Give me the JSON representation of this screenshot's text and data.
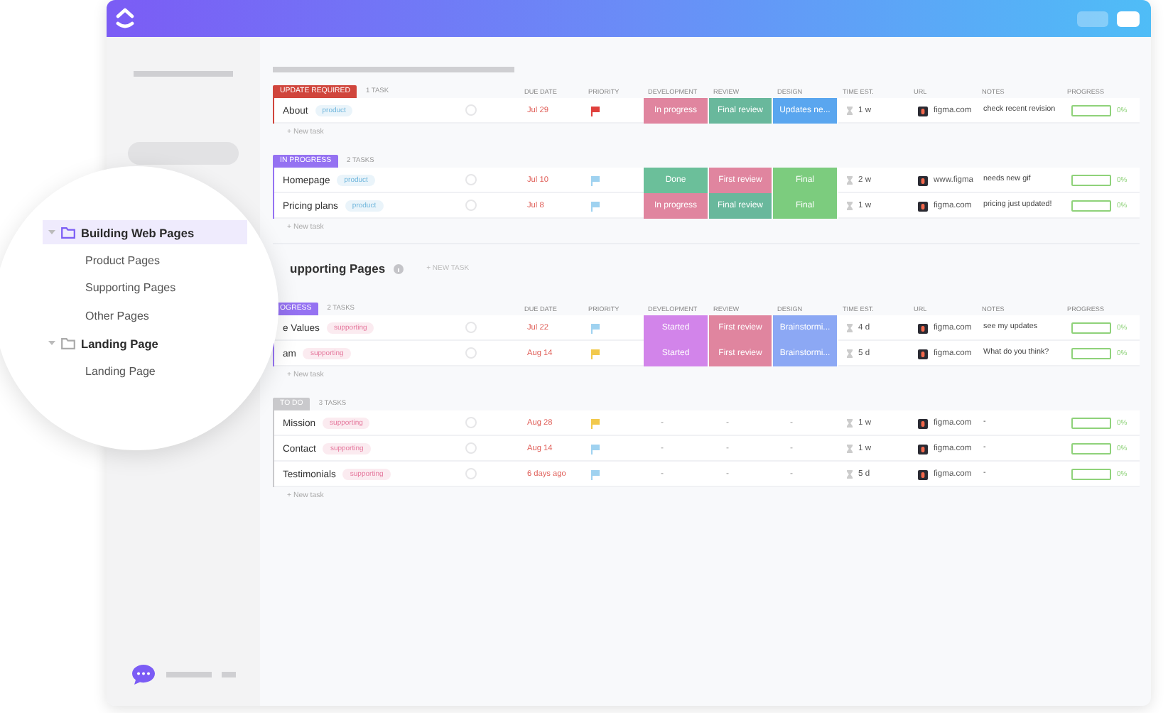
{
  "sections": [
    {
      "groups": [
        {
          "badge": {
            "text": "UPDATE REQUIRED",
            "color": "#d0453c"
          },
          "count": "1 TASK",
          "columns": [
            "DUE DATE",
            "PRIORITY",
            "DEVELOPMENT",
            "REVIEW",
            "DESIGN",
            "TIME EST.",
            "URL",
            "NOTES",
            "PROGRESS"
          ],
          "new_task": "+ New task",
          "rows": [
            {
              "name": "About",
              "tag": {
                "text": "product",
                "color": "#6fb6dc"
              },
              "due": "Jul 29",
              "priority": {
                "color": "#e0403c"
              },
              "development": {
                "text": "In progress",
                "color": "#e0859f"
              },
              "review": {
                "text": "Final review",
                "color": "#69b89c"
              },
              "design": {
                "text": "Updates ne...",
                "color": "#5aa6ef"
              },
              "time": "1 w",
              "url": "figma.com",
              "notes": "check recent revision",
              "progress": {
                "level": 0,
                "reading": "0%"
              }
            }
          ]
        },
        {
          "badge": {
            "text": "IN PROGRESS",
            "color": "#9572f2"
          },
          "count": "2 TASKS",
          "new_task": "+ New task",
          "rows": [
            {
              "name": "Homepage",
              "tag": {
                "text": "product",
                "color": "#6fb6dc"
              },
              "due": "Jul 10",
              "priority": {
                "color": "#9fd2f0"
              },
              "development": {
                "text": "Done",
                "color": "#6bbf9a"
              },
              "review": {
                "text": "First review",
                "color": "#e0859f"
              },
              "design": {
                "text": "Final",
                "color": "#7ccc7e"
              },
              "time": "2 w",
              "url": "www.figma",
              "notes": "needs new gif",
              "progress": {
                "level": 0,
                "reading": "0%"
              }
            },
            {
              "name": "Pricing plans",
              "tag": {
                "text": "product",
                "color": "#6fb6dc"
              },
              "due": "Jul 8",
              "priority": {
                "color": "#9fd2f0"
              },
              "development": {
                "text": "In progress",
                "color": "#e0859f"
              },
              "review": {
                "text": "Final review",
                "color": "#69b89c"
              },
              "design": {
                "text": "Final",
                "color": "#7ccc7e"
              },
              "time": "1 w",
              "url": "figma.com",
              "notes": "pricing just updated!",
              "progress": {
                "level": 0,
                "reading": "0%"
              }
            }
          ]
        }
      ]
    },
    {
      "title": "upporting Pages",
      "new_task": "+ NEW TASK",
      "groups": [
        {
          "badge": {
            "text": "OGRESS",
            "color": "#9572f2"
          },
          "count": "2 TASKS",
          "columns": [
            "DUE DATE",
            "PRIORITY",
            "DEVELOPMENT",
            "REVIEW",
            "DESIGN",
            "TIME EST.",
            "URL",
            "NOTES",
            "PROGRESS"
          ],
          "new_task": "+ New task",
          "rows": [
            {
              "name": "e Values",
              "tag": {
                "text": "supporting",
                "color": "#e5779c"
              },
              "due": "Jul 22",
              "priority": {
                "color": "#9fd2f0"
              },
              "development": {
                "text": "Started",
                "color": "#d284ea"
              },
              "review": {
                "text": "First review",
                "color": "#e0859f"
              },
              "design": {
                "text": "Brainstormi...",
                "color": "#8ca8f4"
              },
              "time": "4 d",
              "url": "figma.com",
              "notes": "see my updates",
              "progress": {
                "level": 0,
                "reading": "0%"
              }
            },
            {
              "name": "am",
              "tag": {
                "text": "supporting",
                "color": "#e5779c"
              },
              "due": "Aug 14",
              "priority": {
                "color": "#f2c94c"
              },
              "development": {
                "text": "Started",
                "color": "#d284ea"
              },
              "review": {
                "text": "First review",
                "color": "#e0859f"
              },
              "design": {
                "text": "Brainstormi...",
                "color": "#8ca8f4"
              },
              "time": "5 d",
              "url": "figma.com",
              "notes": "What do you think?",
              "progress": {
                "level": 0,
                "reading": "0%"
              }
            }
          ]
        },
        {
          "badge": {
            "text": "TO DO",
            "color": "#c9c9cc"
          },
          "count": "3 TASKS",
          "new_task": "+ New task",
          "rows": [
            {
              "name": "Mission",
              "tag": {
                "text": "supporting",
                "color": "#e5779c"
              },
              "due": "Aug 28",
              "priority": {
                "color": "#f2c94c"
              },
              "development": {
                "text": "-"
              },
              "review": {
                "text": "-"
              },
              "design": {
                "text": "-"
              },
              "time": "1 w",
              "url": "figma.com",
              "notes": "-",
              "progress": {
                "level": 0,
                "reading": "0%"
              }
            },
            {
              "name": "Contact",
              "tag": {
                "text": "supporting",
                "color": "#e5779c"
              },
              "due": "Aug 14",
              "priority": {
                "color": "#9fd2f0"
              },
              "development": {
                "text": "-"
              },
              "review": {
                "text": "-"
              },
              "design": {
                "text": "-"
              },
              "time": "1 w",
              "url": "figma.com",
              "notes": "-",
              "progress": {
                "level": 0,
                "reading": "0%"
              }
            },
            {
              "name": "Testimonials",
              "tag": {
                "text": "supporting",
                "color": "#e5779c"
              },
              "due": "6 days ago",
              "priority": {
                "color": "#9fd2f0"
              },
              "development": {
                "text": "-"
              },
              "review": {
                "text": "-"
              },
              "design": {
                "text": "-"
              },
              "time": "5 d",
              "url": "figma.com",
              "notes": "-",
              "progress": {
                "level": 0,
                "reading": "0%"
              }
            }
          ]
        }
      ]
    }
  ],
  "tree": [
    {
      "label": "Building Web Pages",
      "selected": true,
      "expanded": true,
      "children": [
        {
          "label": "Product Pages",
          "selected": false
        },
        {
          "label": "Supporting Pages",
          "selected": false
        },
        {
          "label": "Other Pages",
          "selected": false
        }
      ]
    },
    {
      "label": "Landing Page",
      "selected": false,
      "expanded": true,
      "children": [
        {
          "label": "Landing Page",
          "selected": false
        }
      ]
    }
  ]
}
